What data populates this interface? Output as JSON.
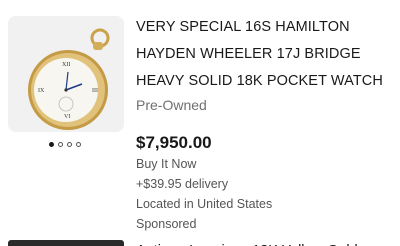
{
  "listing": {
    "title": "VERY SPECIAL 16S HAMILTON HAYDEN WHEELER 17J BRIDGE HEAVY SOLID 18K POCKET WATCH",
    "condition": "Pre-Owned",
    "price": "$7,950.00",
    "format": "Buy It Now",
    "shipping": "+$39.95 delivery",
    "location": "Located in United States",
    "sponsored": "Sponsored",
    "image_count": 4,
    "active_image_index": 0
  },
  "next_listing": {
    "title_partial": "Antique Longines 18K Yellow Gold"
  },
  "colors": {
    "text": "#191919",
    "secondary_text": "#707070",
    "meta_text": "#555555"
  }
}
